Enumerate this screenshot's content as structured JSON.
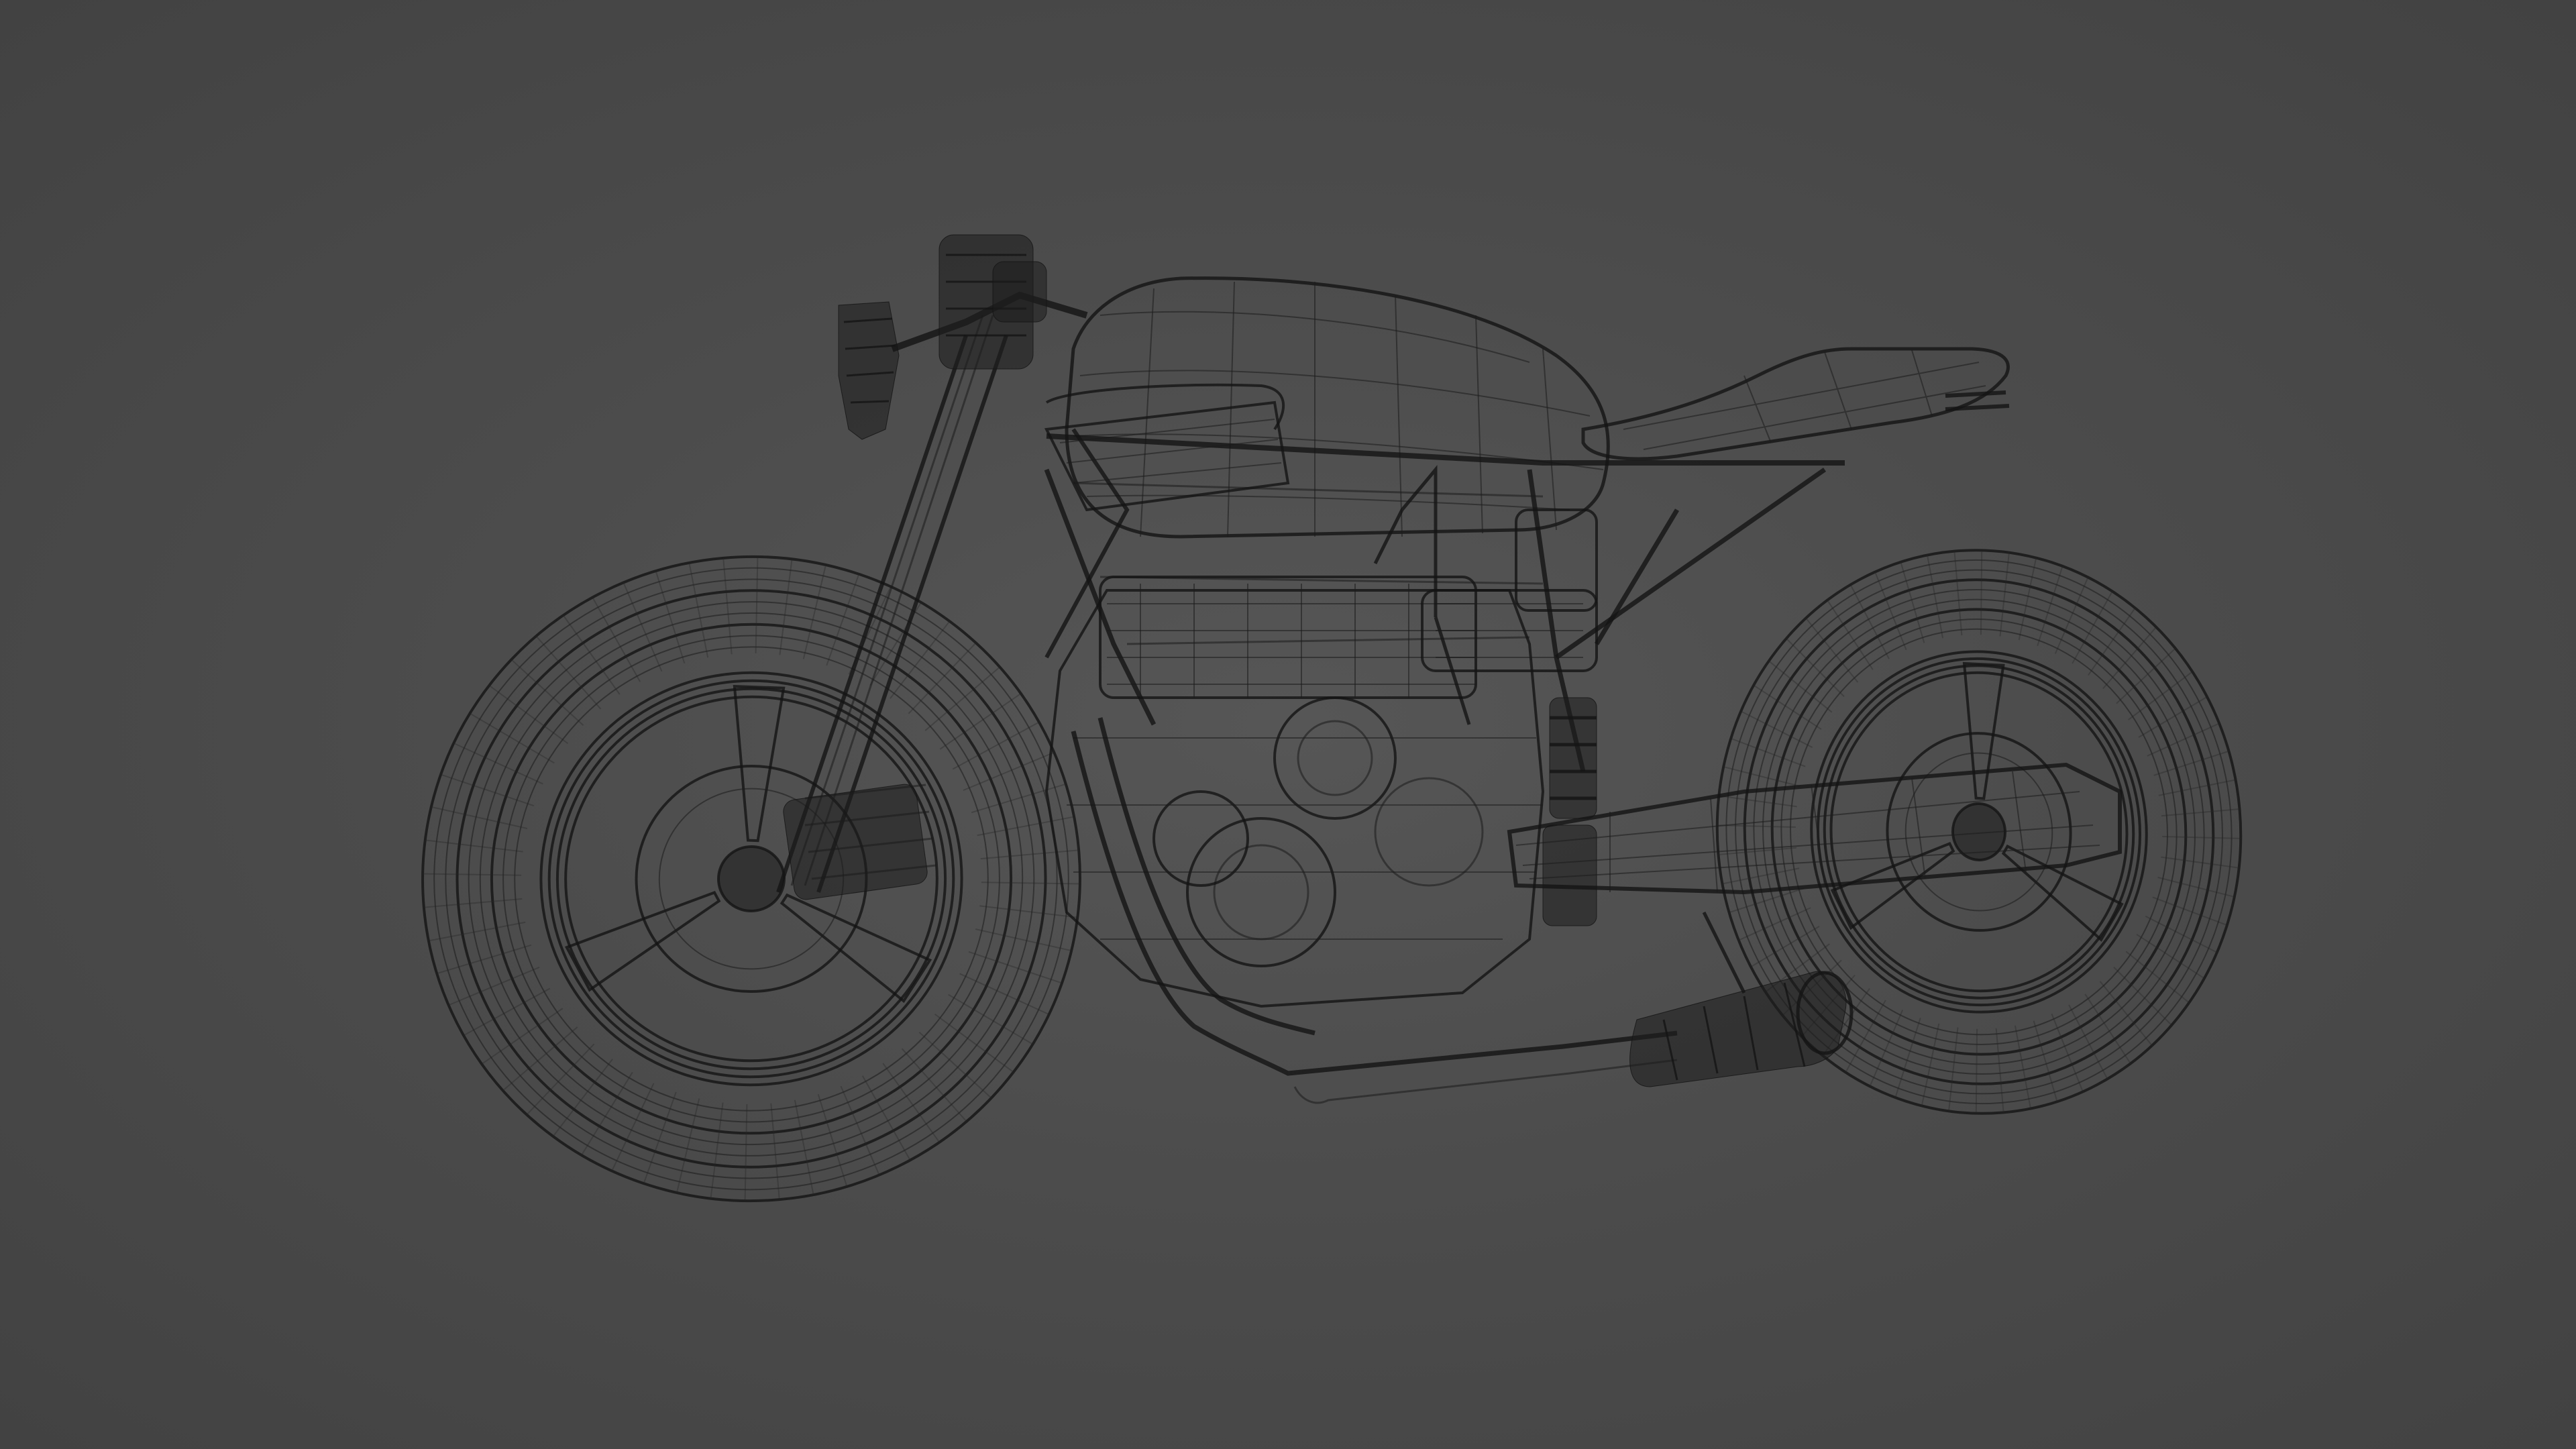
{
  "scene": {
    "background_color": "#4a4a4a",
    "wire_color": "#1c1c1c",
    "subject": "motorcycle-wireframe"
  }
}
